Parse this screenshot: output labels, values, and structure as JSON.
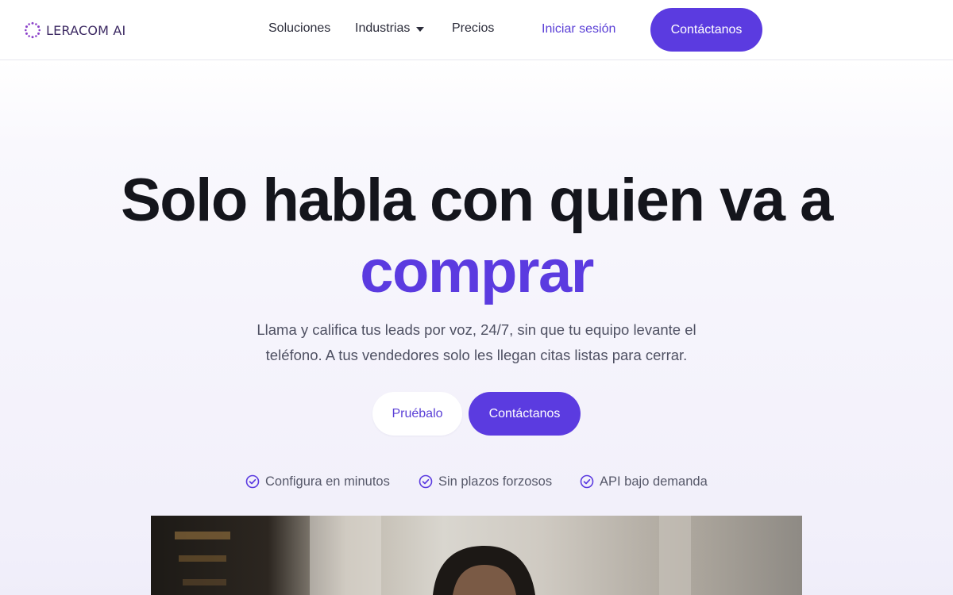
{
  "header": {
    "brand": "LERACOM AI",
    "nav": {
      "soluciones": "Soluciones",
      "industrias": "Industrias",
      "precios": "Precios"
    },
    "login": "Iniciar sesión",
    "contact": "Contáctanos"
  },
  "hero": {
    "title_line1": "Solo habla con quien va a",
    "title_accent": "comprar",
    "subtitle": "Llama y califica tus leads por voz, 24/7, sin que tu equipo levante el teléfono. A tus vendedores solo les llegan citas listas para cerrar.",
    "try_button": "Pruébalo",
    "contact_button": "Contáctanos",
    "features": [
      "Configura en minutos",
      "Sin plazos forzosos",
      "API bajo demanda"
    ]
  },
  "colors": {
    "accent": "#5b3be0",
    "text": "#14151c",
    "muted": "#4f5163"
  },
  "icons": {
    "logo": "dotted-ring-logo-icon",
    "dropdown": "caret-down-icon",
    "feature": "check-circle-icon"
  }
}
